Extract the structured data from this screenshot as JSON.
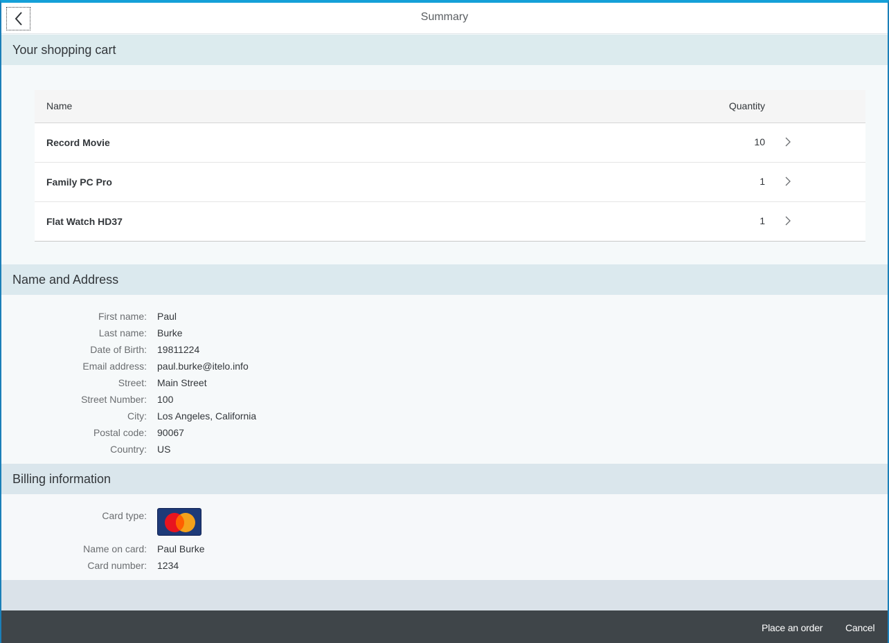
{
  "header": {
    "title": "Summary",
    "back_icon": "chevron-left-icon"
  },
  "cart": {
    "section_title": "Your shopping cart",
    "columns": {
      "name": "Name",
      "quantity": "Quantity"
    },
    "rows": [
      {
        "name": "Record Movie",
        "quantity": "10"
      },
      {
        "name": "Family PC Pro",
        "quantity": "1"
      },
      {
        "name": "Flat Watch HD37",
        "quantity": "1"
      }
    ],
    "row_nav_icon": "chevron-right-icon"
  },
  "address": {
    "section_title": "Name and Address",
    "fields": [
      {
        "label": "First name:",
        "value": "Paul"
      },
      {
        "label": "Last name:",
        "value": "Burke"
      },
      {
        "label": "Date of Birth:",
        "value": "19811224"
      },
      {
        "label": "Email address:",
        "value": "paul.burke@itelo.info"
      },
      {
        "label": "Street:",
        "value": "Main Street"
      },
      {
        "label": "Street Number:",
        "value": "100"
      },
      {
        "label": "City:",
        "value": "Los Angeles, California"
      },
      {
        "label": "Postal code:",
        "value": "90067"
      },
      {
        "label": "Country:",
        "value": "US"
      }
    ]
  },
  "billing": {
    "section_title": "Billing information",
    "card_type_label": "Card type:",
    "card_logo_text": "MasterCard",
    "fields": [
      {
        "label": "Name on card:",
        "value": "Paul Burke"
      },
      {
        "label": "Card number:",
        "value": "1234"
      }
    ]
  },
  "footer": {
    "place_order_label": "Place an order",
    "cancel_label": "Cancel"
  },
  "colors": {
    "accent_top": "#14a0d8",
    "footer_bg": "#3f4549",
    "section_header_bg": "#dcebee"
  }
}
